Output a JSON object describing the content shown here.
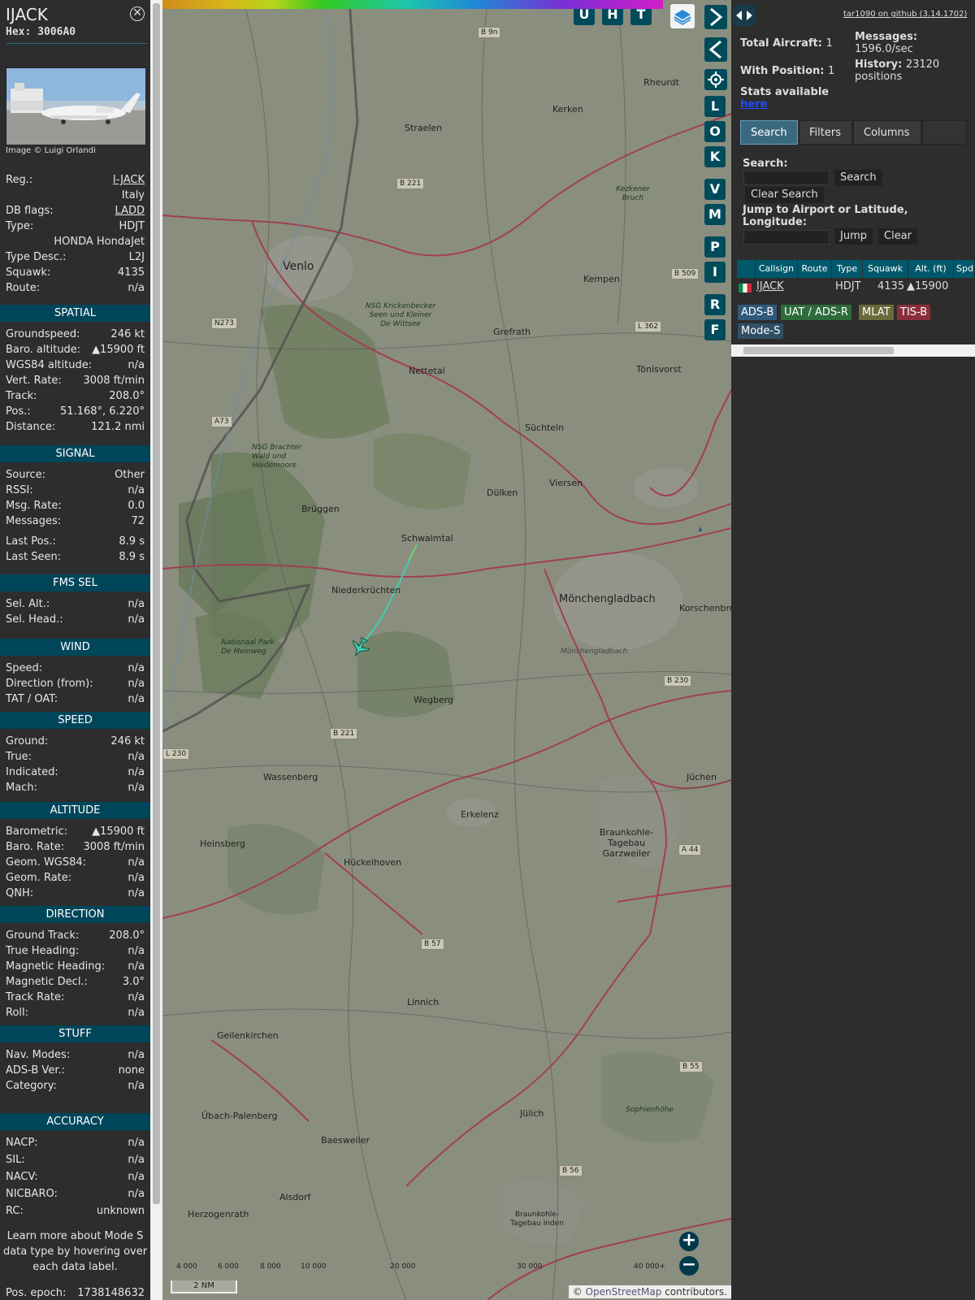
{
  "info": {
    "callsign": "IJACK",
    "hex_label": "Hex:",
    "hex": "3006A0",
    "image_credit": "Image © Luigi Orlandi",
    "basic": [
      {
        "k": "Reg.:",
        "v": "I-JACK",
        "link": true
      },
      {
        "k": "",
        "v": "Italy"
      },
      {
        "k": "DB flags:",
        "v": "LADD",
        "link": true
      },
      {
        "k": "Type:",
        "v": "HDJT"
      },
      {
        "k": "",
        "v": "HONDA HondaJet"
      },
      {
        "k": "Type Desc.:",
        "v": "L2J"
      },
      {
        "k": "Squawk:",
        "v": "4135"
      },
      {
        "k": "Route:",
        "v": "n/a"
      }
    ],
    "sections": [
      {
        "title": "SPATIAL",
        "rows": [
          {
            "k": "Groundspeed:",
            "v": "246 kt"
          },
          {
            "k": "Baro. altitude:",
            "v": "▲15900 ft"
          },
          {
            "k": "WGS84 altitude:",
            "v": "n/a"
          },
          {
            "k": "Vert. Rate:",
            "v": "3008 ft/min"
          },
          {
            "k": "Track:",
            "v": "208.0°"
          },
          {
            "k": "Pos.:",
            "v": "51.168°, 6.220°"
          },
          {
            "k": "Distance:",
            "v": "121.2 nmi"
          }
        ]
      },
      {
        "title": "SIGNAL",
        "rows": [
          {
            "k": "Source:",
            "v": "Other"
          },
          {
            "k": "RSSI:",
            "v": "n/a"
          },
          {
            "k": "Msg. Rate:",
            "v": "0.0"
          },
          {
            "k": "Messages:",
            "v": "72"
          },
          {
            "k": "Last Pos.:",
            "v": "8.9 s"
          },
          {
            "k": "Last Seen:",
            "v": "8.9 s"
          }
        ]
      },
      {
        "title": "FMS SEL",
        "rows": [
          {
            "k": "Sel. Alt.:",
            "v": "n/a"
          },
          {
            "k": "Sel. Head.:",
            "v": "n/a"
          }
        ]
      },
      {
        "title": "WIND",
        "rows": [
          {
            "k": "Speed:",
            "v": "n/a"
          },
          {
            "k": "Direction (from):",
            "v": "n/a"
          },
          {
            "k": "TAT / OAT:",
            "v": "n/a"
          }
        ]
      },
      {
        "title": "SPEED",
        "rows": [
          {
            "k": "Ground:",
            "v": "246 kt"
          },
          {
            "k": "True:",
            "v": "n/a"
          },
          {
            "k": "Indicated:",
            "v": "n/a"
          },
          {
            "k": "Mach:",
            "v": "n/a"
          }
        ]
      },
      {
        "title": "ALTITUDE",
        "rows": [
          {
            "k": "Barometric:",
            "v": "▲15900 ft"
          },
          {
            "k": "Baro. Rate:",
            "v": "3008 ft/min"
          },
          {
            "k": "Geom. WGS84:",
            "v": "n/a"
          },
          {
            "k": "Geom. Rate:",
            "v": "n/a"
          },
          {
            "k": "QNH:",
            "v": "n/a"
          }
        ]
      },
      {
        "title": "DIRECTION",
        "rows": [
          {
            "k": "Ground Track:",
            "v": "208.0°"
          },
          {
            "k": "True Heading:",
            "v": "n/a"
          },
          {
            "k": "Magnetic Heading:",
            "v": "n/a"
          },
          {
            "k": "Magnetic Decl.:",
            "v": "3.0°"
          },
          {
            "k": "Track Rate:",
            "v": "n/a"
          },
          {
            "k": "Roll:",
            "v": "n/a"
          }
        ]
      },
      {
        "title": "STUFF",
        "rows": [
          {
            "k": "Nav. Modes:",
            "v": "n/a"
          },
          {
            "k": "ADS-B Ver.:",
            "v": "none"
          },
          {
            "k": "Category:",
            "v": "n/a"
          }
        ]
      },
      {
        "title": "ACCURACY",
        "rows": [
          {
            "k": "NACP:",
            "v": "n/a"
          },
          {
            "k": "SIL:",
            "v": "n/a"
          },
          {
            "k": "NACV:",
            "v": "n/a"
          },
          {
            "k": "NICBARO:",
            "v": "n/a"
          },
          {
            "k": "RC:",
            "v": "unknown"
          }
        ]
      }
    ],
    "learn_more": "Learn more about Mode S data type by hovering over each data label.",
    "epoch_label": "Pos. epoch:",
    "epoch_value": "1738148632"
  },
  "map": {
    "top_buttons": [
      "U",
      "H",
      "T"
    ],
    "side_buttons": [
      "L",
      "O",
      "K",
      "V",
      "M",
      "P",
      "I",
      "R",
      "F"
    ],
    "places": [
      {
        "name": "Venlo",
        "big": true
      },
      {
        "name": "Straelen"
      },
      {
        "name": "Kerken"
      },
      {
        "name": "Rheurdt"
      },
      {
        "name": "Kempen"
      },
      {
        "name": "Grefrath"
      },
      {
        "name": "Nettetal"
      },
      {
        "name": "Tönisvorst"
      },
      {
        "name": "Süchteln"
      },
      {
        "name": "Viersen"
      },
      {
        "name": "Dülken"
      },
      {
        "name": "Brüggen"
      },
      {
        "name": "Schwalmtal"
      },
      {
        "name": "Niederkrüchten"
      },
      {
        "name": "Mönchengladbach",
        "big": true
      },
      {
        "name": "Korschenbroich"
      },
      {
        "name": "Wegberg"
      },
      {
        "name": "Wassenberg"
      },
      {
        "name": "Erkelenz"
      },
      {
        "name": "Jüchen"
      },
      {
        "name": "Heinsberg"
      },
      {
        "name": "Hückelhoven"
      },
      {
        "name": "Linnich"
      },
      {
        "name": "Geilenkirchen"
      },
      {
        "name": "Übach-Palenberg"
      },
      {
        "name": "Baesweiler"
      },
      {
        "name": "Jülich"
      },
      {
        "name": "Alsdorf"
      },
      {
        "name": "Herzogenrath"
      }
    ],
    "roads": [
      "B 9n",
      "B 221",
      "B 509",
      "L 362",
      "N273",
      "A73",
      "B 230",
      "B 221",
      "L 230",
      "A 44",
      "B 57",
      "B 55",
      "B 56"
    ],
    "nature": [
      "NSG Krickenbecker Seen und Kleiner De Wittsee",
      "NSG Brachter Wald und Heidemoore",
      "Nationaal Park De Meinweg",
      "Braunkohle-Tagebau Garzweiler",
      "Braunkohle-Tagebau Inden",
      "Kezkener Bruch",
      "Sophienhöhe",
      "Mönchengladbach"
    ],
    "altitude_ticks": [
      "4 000",
      "6 000",
      "8 000",
      "10 000",
      "20 000",
      "30 000",
      "40 000+"
    ],
    "scale": "2 NM",
    "attribution_prefix": "©",
    "attribution_link": "OpenStreetMap",
    "attribution_suffix": "contributors."
  },
  "right": {
    "github_link": "tar1090 on github (3.14.1702)",
    "total_aircraft_label": "Total Aircraft:",
    "total_aircraft": "1",
    "with_position_label": "With Position:",
    "with_position": "1",
    "stats_label": "Stats available",
    "stats_link": "here",
    "messages_label": "Messages:",
    "messages_value": "1596.0/sec",
    "history_label": "History:",
    "history_value": "23120 positions",
    "tabs": [
      "Search",
      "Filters",
      "Columns"
    ],
    "search_label": "Search:",
    "search_button": "Search",
    "clear_search_button": "Clear Search",
    "jump_label": "Jump to Airport or Latitude, Longitude:",
    "jump_button": "Jump",
    "clear_button": "Clear",
    "table_headers": [
      "Callsign",
      "Route",
      "Type",
      "Squawk",
      "Alt. (ft)",
      "Spd"
    ],
    "table_row": {
      "callsign": "IJACK",
      "route": "",
      "type": "HDJT",
      "squawk": "4135",
      "alt": "▲15900"
    },
    "badges": [
      {
        "label": "ADS-B",
        "color": "#2f5a7a"
      },
      {
        "label": "UAT / ADS-R",
        "color": "#2e6b3b"
      },
      {
        "label": "MLAT",
        "color": "#6b6a3a"
      },
      {
        "label": "TIS-B",
        "color": "#8a2e3a"
      },
      {
        "label": "Mode-S",
        "color": "#2f4f66"
      }
    ]
  }
}
